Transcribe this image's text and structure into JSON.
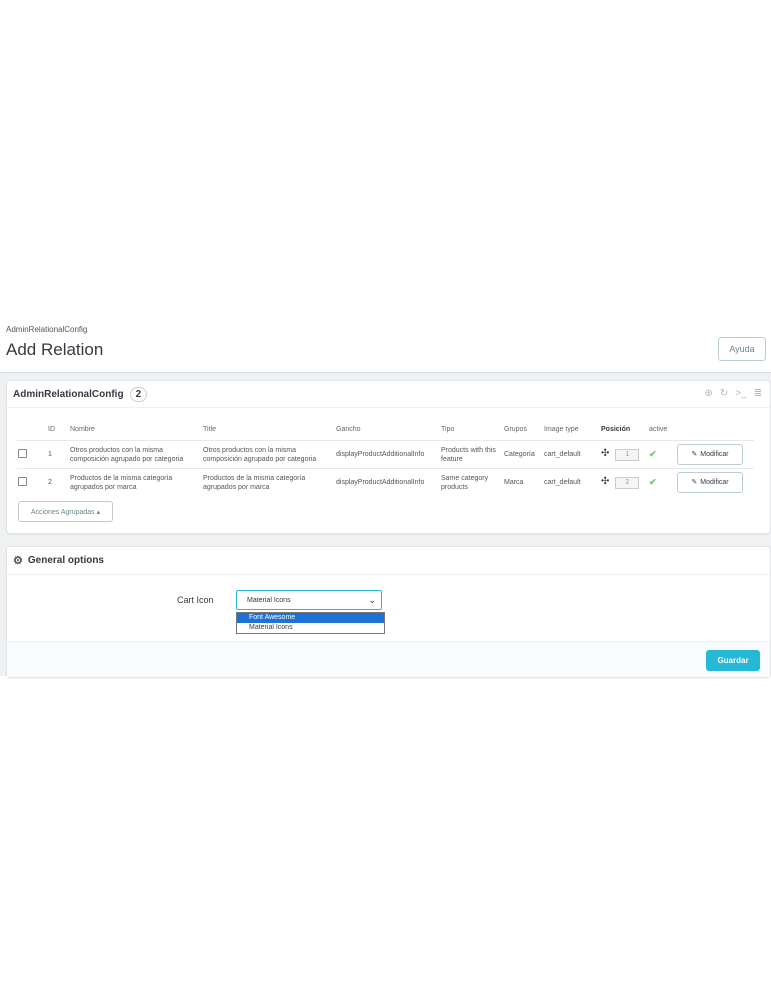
{
  "header": {
    "breadcrumb": "AdminRelationalConfig",
    "title": "Add Relation",
    "help_label": "Ayuda"
  },
  "list_panel": {
    "title": "AdminRelationalConfig",
    "count": "2",
    "icons": [
      "add-icon",
      "refresh-icon",
      "sql-icon",
      "database-icon"
    ],
    "columns": [
      "ID",
      "Nombre",
      "Title",
      "Gancho",
      "Tipo",
      "Grupos",
      "Image type",
      "Posición",
      "active"
    ],
    "rows": [
      {
        "id": "1",
        "nombre": "Otros productos con la misma composición agrupado por categoria",
        "title": "Otros productos con la misma composición agrupado por categoria",
        "gancho": "displayProductAdditionalInfo",
        "tipo": "Products with this feature",
        "grupos": "Categoría",
        "image_type": "cart_default",
        "posicion": "1",
        "active": "✔",
        "action": "Modificar"
      },
      {
        "id": "2",
        "nombre": "Productos de la misma categoría agrupados por marca",
        "title": "Productos de la misma categoría agrupados por marca",
        "gancho": "displayProductAdditionalInfo",
        "tipo": "Same category products",
        "grupos": "Marca",
        "image_type": "cart_default",
        "posicion": "2",
        "active": "✔",
        "action": "Modificar"
      }
    ],
    "bulk_label": "Acciones Agrupadas ▴"
  },
  "options_panel": {
    "title": "General options",
    "cart_icon_label": "Cart Icon",
    "select_value": "Material Icons",
    "options": [
      "Font Awesome",
      "Material Icons"
    ],
    "save_label": "Guardar"
  },
  "colors": {
    "accent": "#25b9d7",
    "active_check": "#72c279",
    "option_highlight": "#1e72d6"
  }
}
